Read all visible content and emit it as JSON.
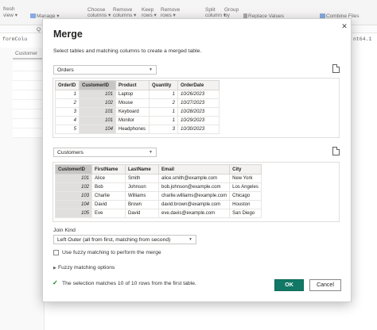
{
  "background": {
    "ribbon": {
      "refresh": "fresh",
      "view": "view ▾",
      "manage": "Manage ▾",
      "choose": "Choose",
      "columns": "columns ▾",
      "remove": "Remove",
      "remove_columns": "columns ▾",
      "keep": "Keep",
      "keep_rows": "rows ▾",
      "remove2": "Remove",
      "remove_rows": "rows ▾",
      "split": "Split",
      "split_column": "column ▾",
      "group": "Group",
      "group_by": "by",
      "replace_values": "Replace Values",
      "combine_files": "Combine Files"
    },
    "formula_left": "formColu",
    "formula_right": "nt64.1",
    "query_tab": "Customer",
    "q_label": "Q"
  },
  "dialog": {
    "title": "Merge",
    "subtitle": "Select tables and matching columns to create a merged table.",
    "close_glyph": "✕",
    "table1": {
      "selected": "Orders",
      "columns": [
        "OrderID",
        "CustomerID",
        "Product",
        "Quantity",
        "OrderDate"
      ],
      "rows": [
        [
          "1",
          "101",
          "Laptop",
          "1",
          "10/26/2023"
        ],
        [
          "2",
          "102",
          "Mouse",
          "2",
          "10/27/2023"
        ],
        [
          "3",
          "101",
          "Keyboard",
          "1",
          "10/28/2023"
        ],
        [
          "4",
          "101",
          "Monitor",
          "1",
          "10/29/2023"
        ],
        [
          "5",
          "104",
          "Headphones",
          "3",
          "10/30/2023"
        ]
      ]
    },
    "table2": {
      "selected": "Customers",
      "columns": [
        "CustomerID",
        "FirstName",
        "LastName",
        "Email",
        "City"
      ],
      "rows": [
        [
          "101",
          "Alice",
          "Smith",
          "alice.smith@example.com",
          "New York"
        ],
        [
          "102",
          "Bob",
          "Johnson",
          "bob.johnson@example.com",
          "Los Angeles"
        ],
        [
          "103",
          "Charlie",
          "Williams",
          "charlie.williams@example.com",
          "Chicago"
        ],
        [
          "104",
          "David",
          "Brown",
          "david.brown@example.com",
          "Houston"
        ],
        [
          "105",
          "Eve",
          "David",
          "eve.davis@example.com",
          "San Diego"
        ]
      ]
    },
    "join_kind_label": "Join Kind",
    "join_kind_value": "Left Outer (all from first, matching from second)",
    "fuzzy_checkbox_label": "Use fuzzy matching to perform the merge",
    "fuzzy_options_label": "Fuzzy matching options",
    "status": "The selection matches 10 of 10 rows from the first table.",
    "ok_label": "OK",
    "cancel_label": "Cancel"
  },
  "colors": {
    "accent": "#117865",
    "status_check": "#107c10"
  }
}
